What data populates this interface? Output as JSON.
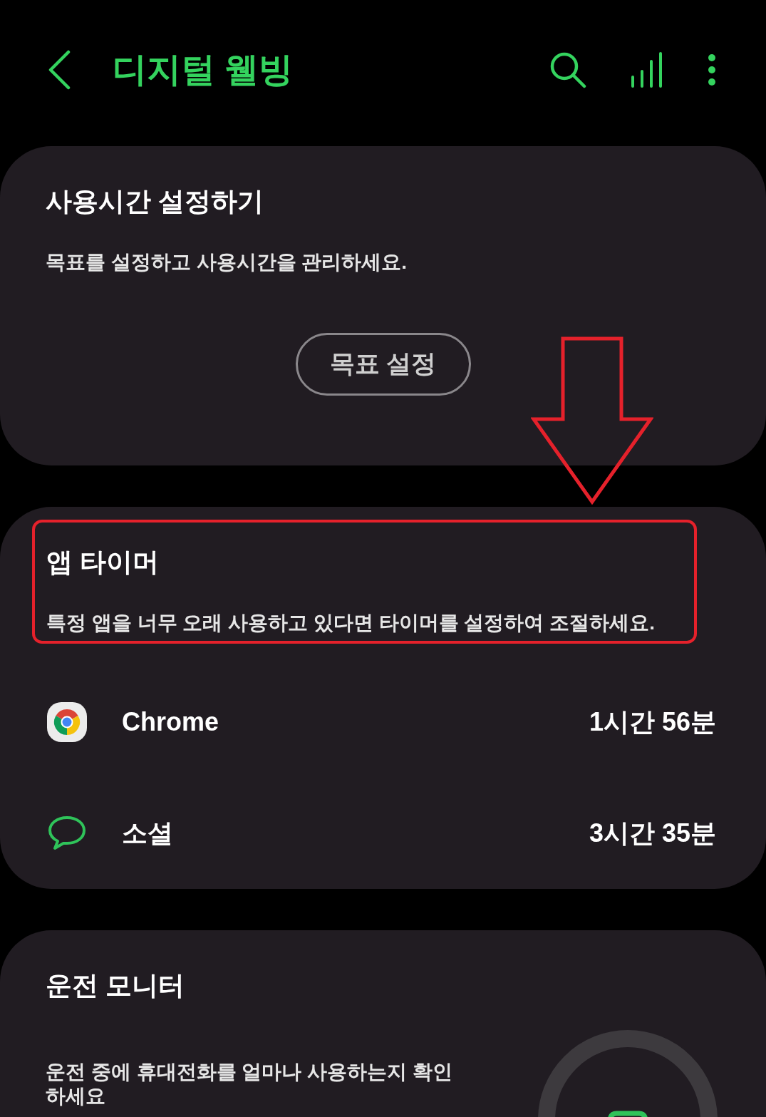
{
  "header": {
    "title": "디지털 웰빙"
  },
  "goal_card": {
    "title": "사용시간 설정하기",
    "description": "목표를 설정하고 사용시간을 관리하세요.",
    "button": "목표 설정"
  },
  "app_timer_card": {
    "title": "앱 타이머",
    "description": "특정 앱을 너무 오래 사용하고 있다면 타이머를 설정하여 조절하세요.",
    "apps": [
      {
        "name": "Chrome",
        "usage": "1시간 56분",
        "kind": "chrome"
      },
      {
        "name": "소셜",
        "usage": "3시간 35분",
        "kind": "social"
      }
    ]
  },
  "driving_card": {
    "title": "운전 모니터",
    "description": "운전 중에 휴대전화를 얼마나 사용하는지 확인하세요"
  }
}
